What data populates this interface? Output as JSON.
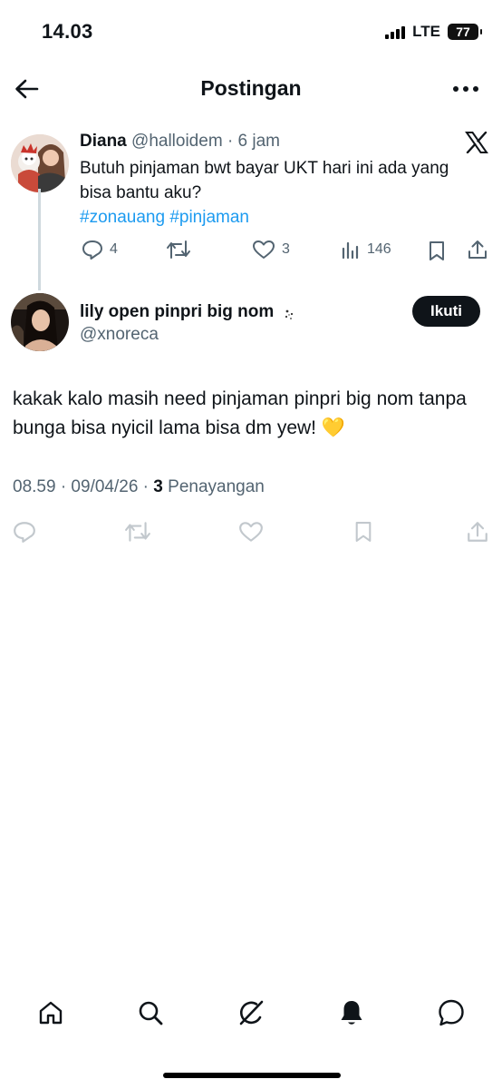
{
  "status_bar": {
    "time": "14.03",
    "network": "LTE",
    "battery": "77"
  },
  "header": {
    "title": "Postingan"
  },
  "reply_tweet": {
    "name": "Diana",
    "handle": "@halloidem",
    "time": "· 6 jam",
    "text": "Butuh pinjaman bwt bayar UKT hari ini ada yang bisa bantu aku?",
    "hashtags": "#zonauang #pinjaman",
    "reply_count": "4",
    "retweet_count": "",
    "like_count": "3",
    "view_count": "146"
  },
  "main_tweet": {
    "name": "lily open pinpri big nom",
    "handle": "@xnoreca",
    "follow_label": "Ikuti",
    "text": "kakak kalo masih need pinjaman pinpri big nom tanpa bunga bisa nyicil lama bisa dm yew! 💛",
    "timestamp": "08.59 · 09/04/26 · ",
    "views_count": "3",
    "views_label": "Penayangan"
  },
  "icons": {
    "back": "arrow-left-icon",
    "more": "more-dots-icon",
    "x_logo": "x-logo-icon",
    "reply": "reply-icon",
    "retweet": "retweet-icon",
    "like": "heart-icon",
    "views": "bar-chart-icon",
    "bookmark": "bookmark-icon",
    "share": "share-icon",
    "nav": [
      "home-icon",
      "search-icon",
      "grok-icon",
      "bell-icon",
      "message-icon"
    ]
  }
}
